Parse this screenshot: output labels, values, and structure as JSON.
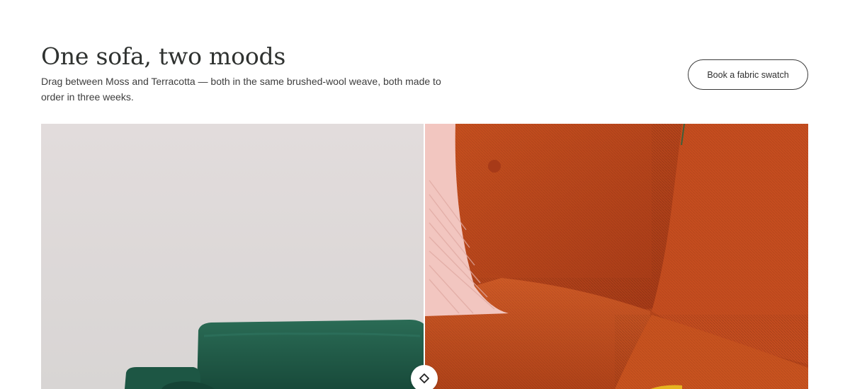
{
  "header": {
    "title": "One sofa, two moods",
    "subtitle": "Drag between Moss and Terracotta — both in the same brushed-wool weave, both made to order in three weeks.",
    "cta_label": "Book a fabric swatch"
  },
  "comparison": {
    "left_variant": "Moss",
    "right_variant": "Terracotta",
    "slider_position": 0.5,
    "handle_icon": "diamond-arrows-icon",
    "colors": {
      "moss": "#1f5a47",
      "terracotta": "#c24a22",
      "wall": "#dcd6d6"
    }
  }
}
